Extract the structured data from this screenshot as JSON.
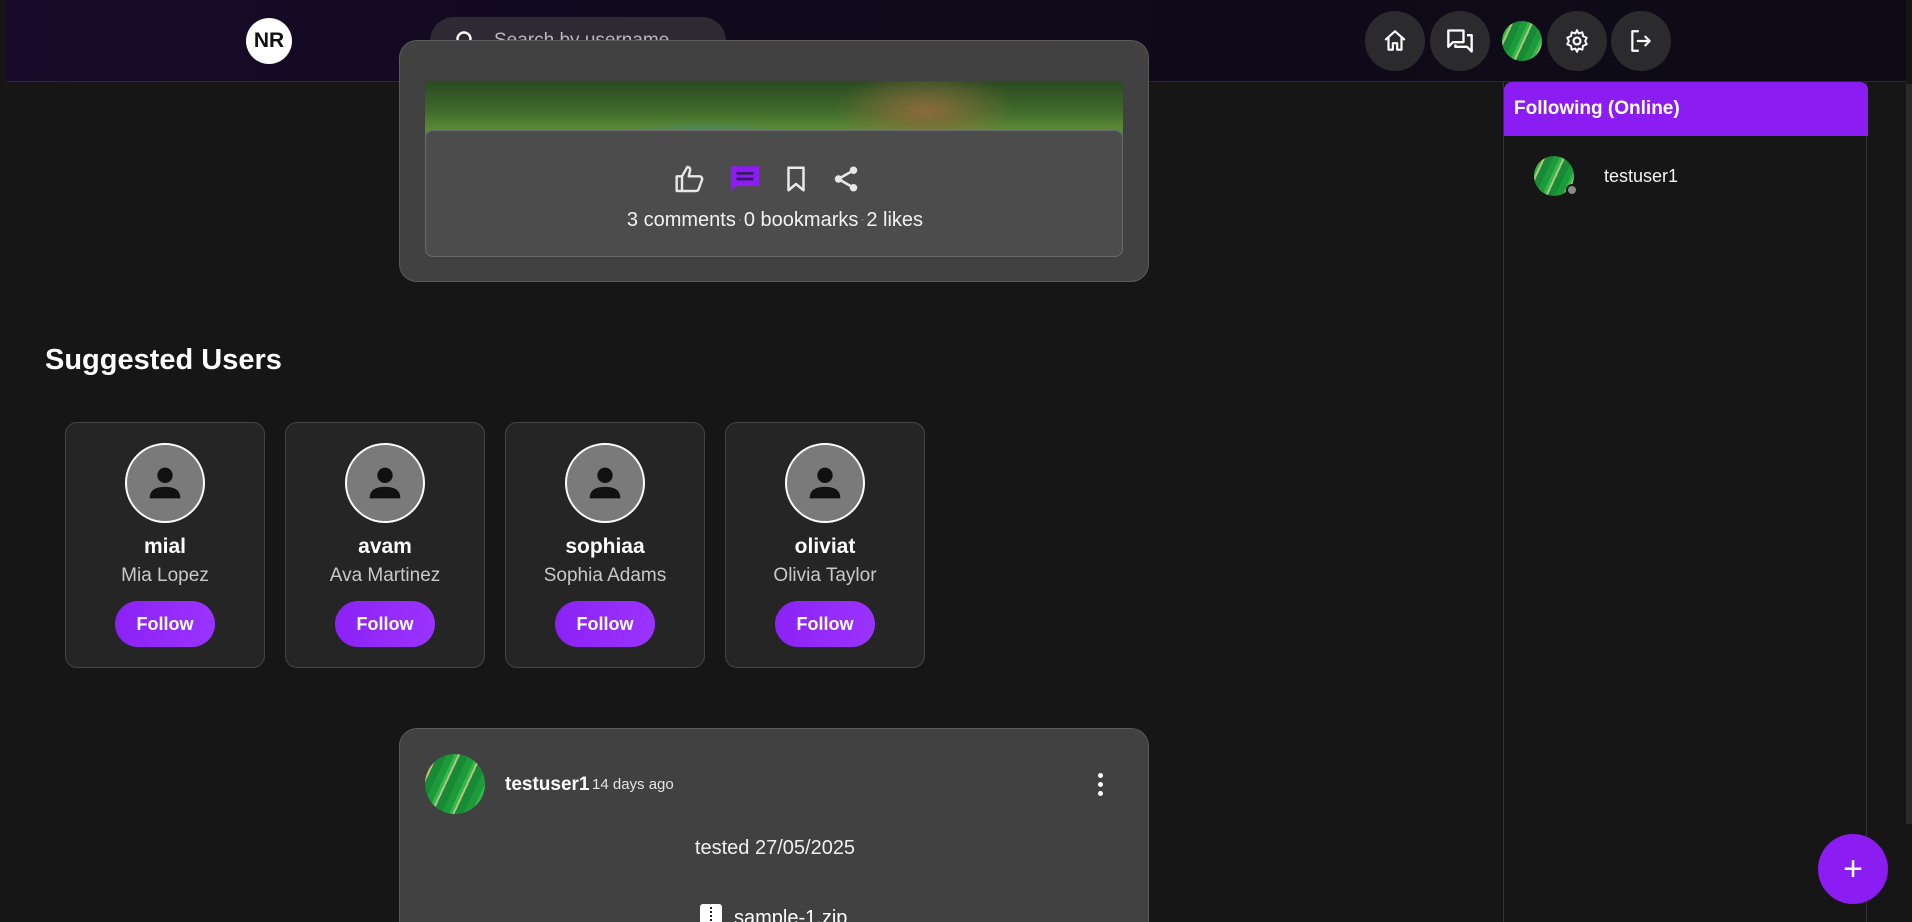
{
  "navbar": {
    "logo_text": "NR",
    "search_placeholder": "Search by username...",
    "icons": [
      "home-icon",
      "chat-icon",
      "avatar",
      "gear-icon",
      "logout-icon"
    ]
  },
  "post_top": {
    "icons": [
      "thumb-up-icon",
      "comment-icon",
      "bookmark-icon",
      "share-icon"
    ],
    "comments": "3 comments",
    "bookmarks": "0 bookmarks",
    "likes": "2 likes",
    "separator": "·"
  },
  "suggested": {
    "title": "Suggested Users",
    "users": [
      {
        "username": "mial",
        "fullname": "Mia Lopez",
        "button": "Follow"
      },
      {
        "username": "avam",
        "fullname": "Ava Martinez",
        "button": "Follow"
      },
      {
        "username": "sophiaa",
        "fullname": "Sophia Adams",
        "button": "Follow"
      },
      {
        "username": "oliviat",
        "fullname": "Olivia Taylor",
        "button": "Follow"
      }
    ]
  },
  "post_bottom": {
    "username": "testuser1",
    "time": "14 days ago",
    "text": "tested 27/05/2025",
    "file": "sample-1.zip"
  },
  "sidebar": {
    "title": "Following (Online)",
    "friends": [
      {
        "name": "testuser1",
        "status": "offline"
      }
    ]
  },
  "fab": {
    "label": "+"
  },
  "colors": {
    "accent": "#8b1df2",
    "background": "#161616",
    "card": "#414141"
  }
}
